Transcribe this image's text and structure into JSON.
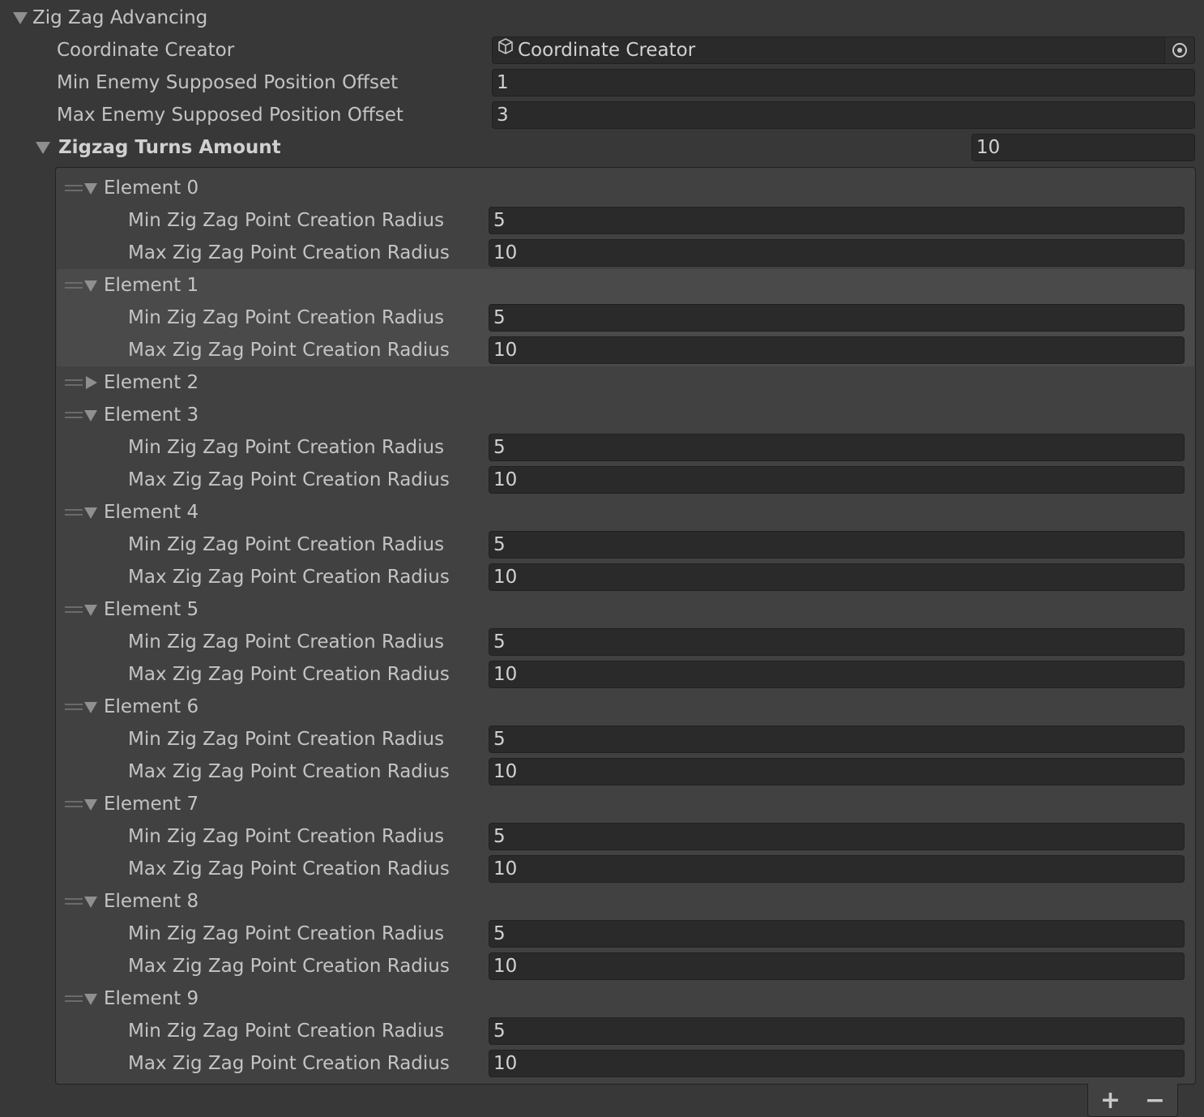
{
  "header": {
    "title": "Zig Zag Advancing"
  },
  "fields": {
    "coordinate_creator": {
      "label": "Coordinate Creator",
      "value": "Coordinate Creator",
      "icon": "cube-icon"
    },
    "min_offset": {
      "label": "Min Enemy Supposed Position Offset",
      "value": "1"
    },
    "max_offset": {
      "label": "Max Enemy Supposed Position Offset",
      "value": "3"
    }
  },
  "list": {
    "label": "Zigzag Turns Amount",
    "size": "10",
    "min_label": "Min Zig Zag Point Creation Radius",
    "max_label": "Max Zig Zag Point Creation Radius",
    "elements": [
      {
        "label": "Element 0",
        "expanded": true,
        "min": "5",
        "max": "10"
      },
      {
        "label": "Element 1",
        "expanded": true,
        "min": "5",
        "max": "10"
      },
      {
        "label": "Element 2",
        "expanded": false
      },
      {
        "label": "Element 3",
        "expanded": true,
        "min": "5",
        "max": "10"
      },
      {
        "label": "Element 4",
        "expanded": true,
        "min": "5",
        "max": "10"
      },
      {
        "label": "Element 5",
        "expanded": true,
        "min": "5",
        "max": "10"
      },
      {
        "label": "Element 6",
        "expanded": true,
        "min": "5",
        "max": "10"
      },
      {
        "label": "Element 7",
        "expanded": true,
        "min": "5",
        "max": "10"
      },
      {
        "label": "Element 8",
        "expanded": true,
        "min": "5",
        "max": "10"
      },
      {
        "label": "Element 9",
        "expanded": true,
        "min": "5",
        "max": "10"
      }
    ],
    "add_label": "+",
    "remove_label": "−"
  }
}
